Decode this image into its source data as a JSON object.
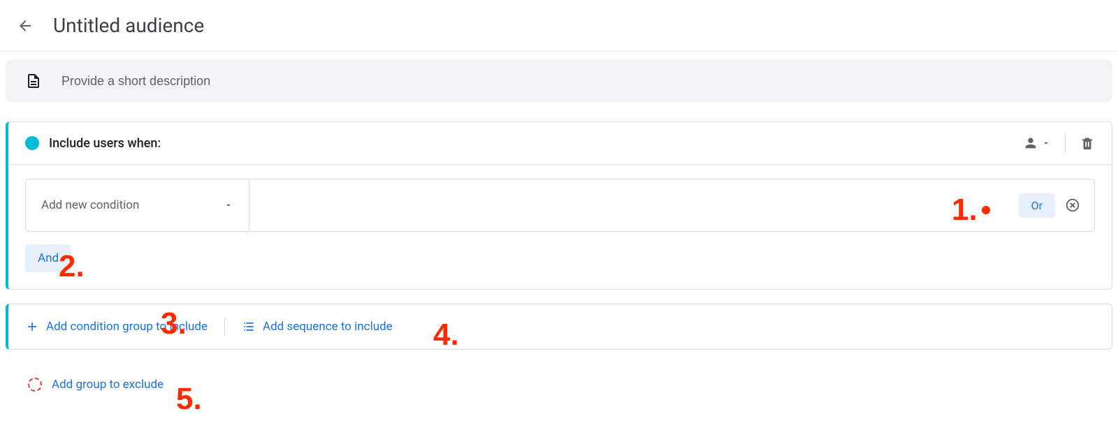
{
  "header": {
    "title": "Untitled audience"
  },
  "description": {
    "placeholder": "Provide a short description"
  },
  "include_group": {
    "title": "Include users when:",
    "condition_placeholder": "Add new condition",
    "or_label": "Or",
    "and_label": "And"
  },
  "actions": {
    "add_condition_group": "Add condition group to include",
    "add_sequence": "Add sequence to include",
    "add_exclude_group": "Add group to exclude"
  },
  "annotations": {
    "n1": "1.",
    "n2": "2.",
    "n3": "3.",
    "n4": "4.",
    "n5": "5."
  }
}
